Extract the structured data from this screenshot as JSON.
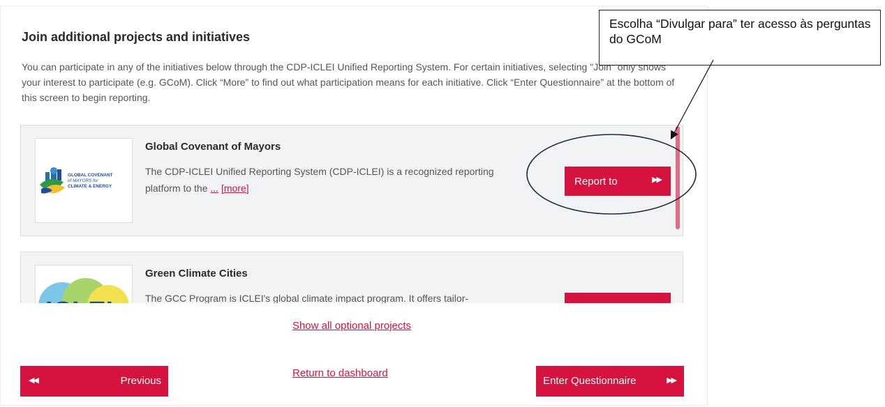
{
  "section": {
    "heading": "Join additional projects and initiatives",
    "intro": "You can participate in any of the initiatives below through the CDP-ICLEI Unified Reporting System. For certain initiatives, selecting \"Join\" only shows your interest to participate (e.g. GCoM). Click “More” to find out what participation means for each initiative. Click “Enter Questionnaire” at the bottom of this screen to begin reporting."
  },
  "initiatives": [
    {
      "title": "Global Covenant of Mayors",
      "description": "The CDP-ICLEI Unified Reporting System (CDP-ICLEI) is a recognized reporting platform to the",
      "ellipsis": "...",
      "more_label": "[more]",
      "button_label": "Report to",
      "logo_text": [
        "GLOBAL COVENANT",
        "of MAYORS for",
        "CLIMATE & ENERGY"
      ]
    },
    {
      "title": "Green Climate Cities",
      "description": "The GCC Program is ICLEI's global climate impact program. It offers tailor-",
      "logo_text": "ICLEI"
    }
  ],
  "footer": {
    "show_all_label": "Show all optional projects",
    "previous_label": "Previous",
    "return_label": "Return to dashboard",
    "enter_label": "Enter Questionnaire"
  },
  "annotation": {
    "callout_text": "Escolha “Divulgar para” ter acesso às perguntas do GCoM"
  },
  "colors": {
    "accent": "#d6133e",
    "card_bg": "#f2f3f4",
    "scrollbar": "#e06b85"
  },
  "icons": {
    "forward": "double-chevron-right-icon",
    "back": "double-chevron-left-icon"
  }
}
